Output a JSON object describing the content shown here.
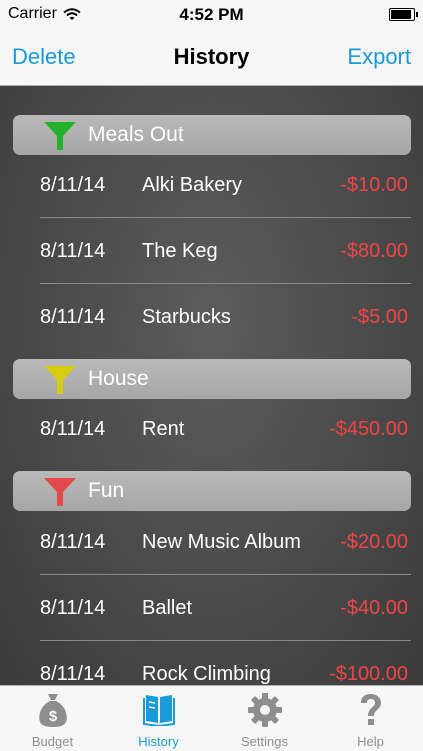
{
  "status": {
    "carrier": "Carrier",
    "time": "4:52 PM",
    "battery_level": 0.95
  },
  "nav": {
    "title": "History",
    "left_button": "Delete",
    "right_button": "Export"
  },
  "sections": [
    {
      "name": "Meals Out",
      "funnel_color": "#22b22a",
      "transactions": [
        {
          "date": "8/11/14",
          "name": "Alki Bakery",
          "amount": "-$10.00"
        },
        {
          "date": "8/11/14",
          "name": "The Keg",
          "amount": "-$80.00"
        },
        {
          "date": "8/11/14",
          "name": "Starbucks",
          "amount": "-$5.00"
        }
      ]
    },
    {
      "name": "House",
      "funnel_color": "#d6cc10",
      "transactions": [
        {
          "date": "8/11/14",
          "name": "Rent",
          "amount": "-$450.00"
        }
      ]
    },
    {
      "name": "Fun",
      "funnel_color": "#e04a4a",
      "transactions": [
        {
          "date": "8/11/14",
          "name": "New Music Album",
          "amount": "-$20.00"
        },
        {
          "date": "8/11/14",
          "name": "Ballet",
          "amount": "-$40.00"
        },
        {
          "date": "8/11/14",
          "name": "Rock Climbing",
          "amount": "-$100.00"
        }
      ]
    }
  ],
  "tabs": [
    {
      "label": "Budget",
      "icon": "money-bag-icon",
      "active": false
    },
    {
      "label": "History",
      "icon": "book-icon",
      "active": true
    },
    {
      "label": "Settings",
      "icon": "gear-icon",
      "active": false
    },
    {
      "label": "Help",
      "icon": "question-mark-icon",
      "active": false
    }
  ],
  "colors": {
    "accent": "#1a9ad6",
    "negative_amount": "#f04545",
    "inactive_tab": "#8e8e8e"
  }
}
